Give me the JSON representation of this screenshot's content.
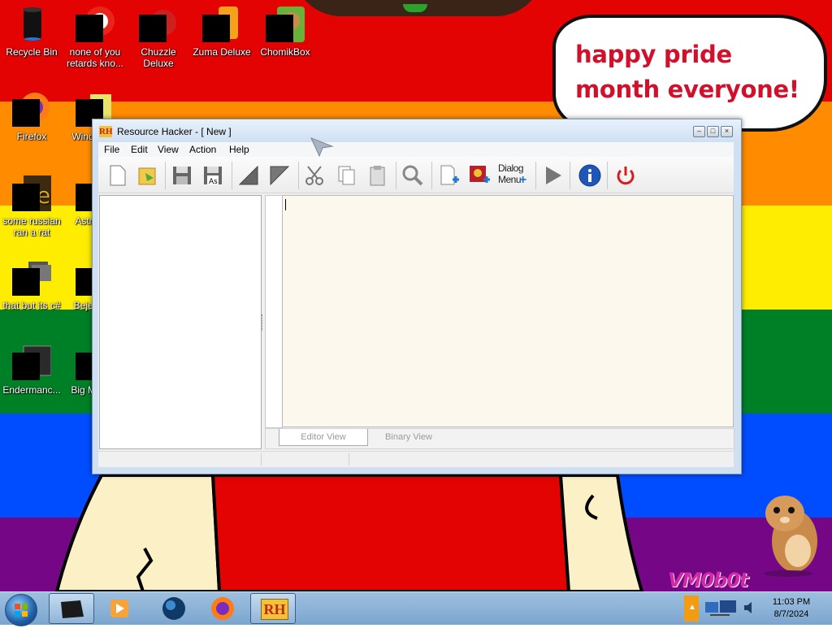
{
  "desktop": {
    "icons": [
      {
        "label": "Recycle Bin"
      },
      {
        "label": "none of you retards kno..."
      },
      {
        "label": "Chuzzle Deluxe"
      },
      {
        "label": "Zuma Deluxe"
      },
      {
        "label": "ChomikBox"
      },
      {
        "label": "Firefox"
      },
      {
        "label": "Windo... M"
      },
      {
        "label": "some russian ran a rat"
      },
      {
        "label": "Astr... De"
      },
      {
        "label": "that but its c#"
      },
      {
        "label": "Beje... De"
      },
      {
        "label": "Endermanc..."
      },
      {
        "label": "Big M... De"
      }
    ],
    "bubble_text": "happy pride month everyone!",
    "watermark": "VM0b0t"
  },
  "window": {
    "title": "Resource Hacker - [ New ]",
    "app_icon": "RH",
    "menu": [
      "File",
      "Edit",
      "View",
      "Action",
      "Help"
    ],
    "toolbar": {
      "dialog_label_line1": "Dialog",
      "dialog_label_line2": "Menu"
    },
    "tabs": [
      "Editor View",
      "Binary View"
    ]
  },
  "taskbar": {
    "time": "11:03 PM",
    "date": "8/7/2024",
    "rh_label": "RH"
  },
  "colors": {
    "red": "#e40303",
    "orange": "#ff8c00",
    "yellow": "#ffed00",
    "green": "#008026",
    "blue": "#004dff",
    "purple": "#750787",
    "bubble_text": "#d1102b"
  }
}
